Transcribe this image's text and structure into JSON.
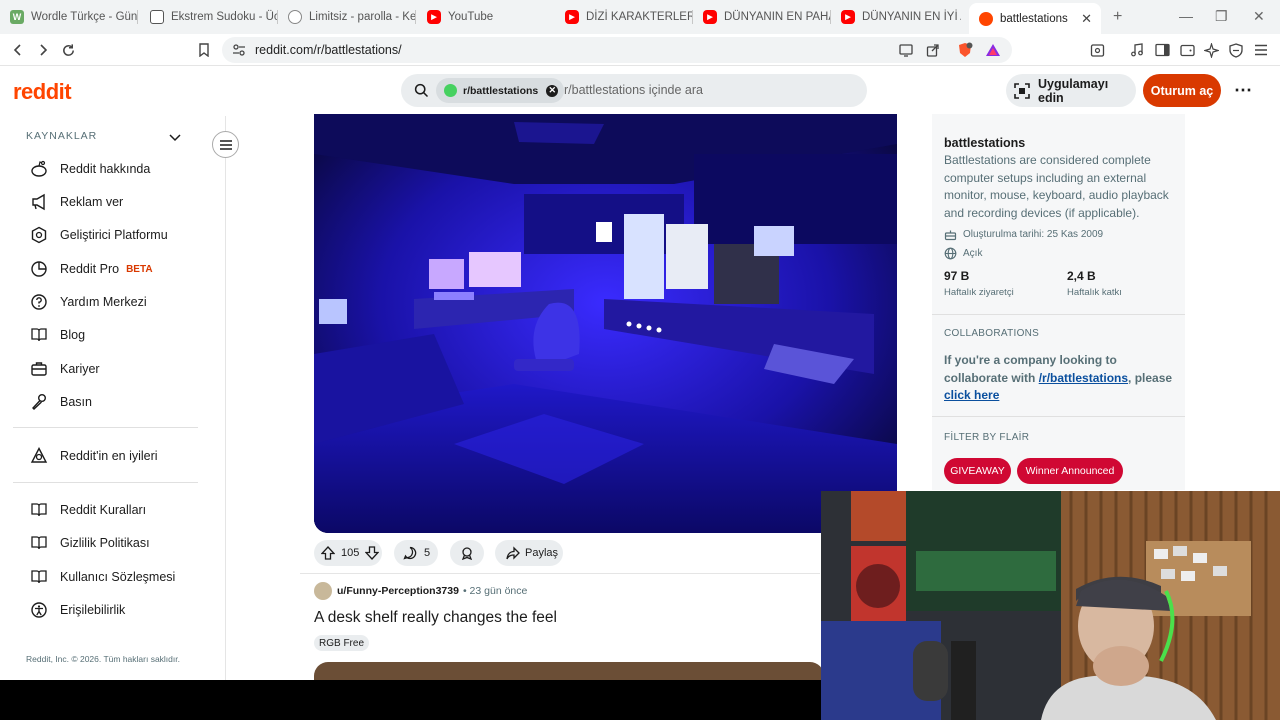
{
  "browser": {
    "tabs": [
      {
        "title": "Wordle Türkçe - Günlük",
        "favicon": "wordle-icon",
        "color": "#6aaa64"
      },
      {
        "title": "Ekstrem Sudoku - Ücr",
        "favicon": "sudoku-icon",
        "color": "#555555"
      },
      {
        "title": "Limitsiz - parolla - Ke",
        "favicon": "parolla-icon",
        "color": "#888888"
      },
      {
        "title": "YouTube",
        "favicon": "youtube-icon",
        "color": "#ff0000"
      },
      {
        "title": "DİZİ KARAKTERLERİN",
        "favicon": "youtube-icon",
        "color": "#ff0000"
      },
      {
        "title": "DÜNYANIN EN PAHAL",
        "favicon": "youtube-icon",
        "color": "#ff0000"
      },
      {
        "title": "DÜNYANIN EN İYİ AR",
        "favicon": "youtube-icon",
        "color": "#ff0000"
      },
      {
        "title": "battlestations",
        "favicon": "reddit-icon",
        "color": "#ff4500",
        "active": true
      }
    ],
    "url": "reddit.com/r/battlestations/"
  },
  "header": {
    "logo": "reddit",
    "search_chip": "r/battlestations",
    "search_placeholder": "r/battlestations içinde ara",
    "app_button": "Uygulamayı edin",
    "login_button": "Oturum aç"
  },
  "sidebar": {
    "section_title": "KAYNAKLAR",
    "items": [
      {
        "label": "Reddit hakkında",
        "icon": "reddit-alien-icon"
      },
      {
        "label": "Reklam ver",
        "icon": "megaphone-icon"
      },
      {
        "label": "Geliştirici Platformu",
        "icon": "developer-icon"
      },
      {
        "label": "Reddit Pro",
        "icon": "pro-chart-icon",
        "badge": "BETA"
      },
      {
        "label": "Yardım Merkezi",
        "icon": "help-icon"
      },
      {
        "label": "Blog",
        "icon": "book-icon"
      },
      {
        "label": "Kariyer",
        "icon": "briefcase-icon"
      },
      {
        "label": "Basın",
        "icon": "microphone-icon"
      }
    ],
    "best_of": {
      "label": "Reddit'in en iyileri",
      "icon": "best-of-icon"
    },
    "policies": [
      {
        "label": "Reddit Kuralları",
        "icon": "rules-book-icon"
      },
      {
        "label": "Gizlilik Politikası",
        "icon": "privacy-book-icon"
      },
      {
        "label": "Kullanıcı Sözleşmesi",
        "icon": "agreement-book-icon"
      },
      {
        "label": "Erişilebilirlik",
        "icon": "accessibility-icon"
      }
    ],
    "copyright": "Reddit, Inc. © 2026. Tüm hakları saklıdır."
  },
  "post": {
    "upvotes": "105",
    "comments": "5",
    "share": "Paylaş"
  },
  "next_post": {
    "author": "u/Funny-Perception3739",
    "time": "• 23 gün önce",
    "title": "A desk shelf really changes the feel",
    "flair": "RGB Free"
  },
  "community": {
    "name": "battlestations",
    "description": "Battlestations are considered complete computer setups including an external monitor, mouse, keyboard, audio playback and recording devices (if applicable).",
    "created": "Oluşturulma tarihi: 25 Kas 2009",
    "visibility": "Açık",
    "visitors_value": "97 B",
    "visitors_label": "Haftalık ziyaretçi",
    "contrib_value": "2,4 B",
    "contrib_label": "Haftalık katkı",
    "collab_title": "COLLABORATIONS",
    "collab_text_1": "If you're a company looking to collaborate with ",
    "collab_link": "/r/battlestations",
    "collab_text_2": ", please",
    "collab_click": "click here",
    "flair_title": "FİLTER BY FLAİR",
    "flairs": [
      "GIVEAWAY",
      "Winner Announced"
    ]
  }
}
